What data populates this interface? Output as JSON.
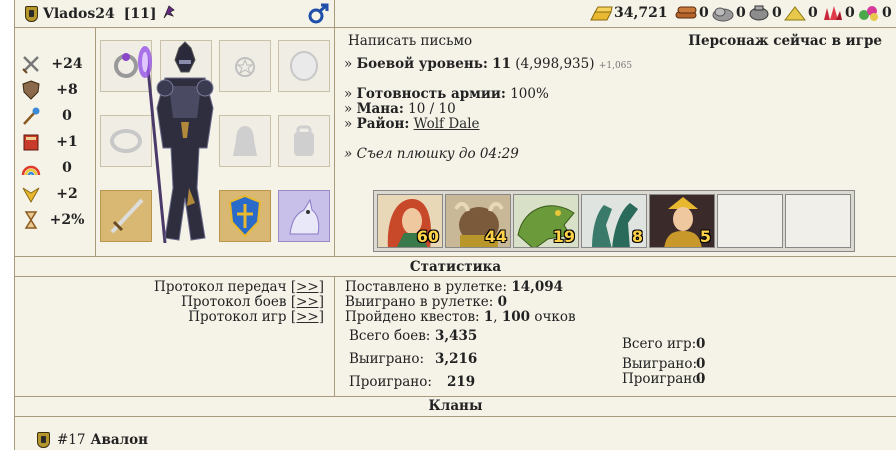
{
  "player": {
    "name": "Vlados24",
    "level_badge": "[11]",
    "gender_icon": "male-icon"
  },
  "resources": [
    {
      "name": "gold",
      "value": "34,721",
      "color": "#e8b830"
    },
    {
      "name": "wood",
      "value": "0",
      "color": "#b5652a"
    },
    {
      "name": "ore",
      "value": "0",
      "color": "#9a9a9a"
    },
    {
      "name": "mercury",
      "value": "0",
      "color": "#8c8c8c"
    },
    {
      "name": "sulfur",
      "value": "0",
      "color": "#e8c84a"
    },
    {
      "name": "crystals",
      "value": "0",
      "color": "#c8283a"
    },
    {
      "name": "gems",
      "value": "0",
      "color": "#4aa84a"
    }
  ],
  "stats": [
    {
      "icon": "attack-icon",
      "value": "+24"
    },
    {
      "icon": "defense-icon",
      "value": "+8"
    },
    {
      "icon": "spellpower-icon",
      "value": "0"
    },
    {
      "icon": "knowledge-icon",
      "value": "+1"
    },
    {
      "icon": "luck-icon",
      "value": "0"
    },
    {
      "icon": "morale-icon",
      "value": "+2"
    },
    {
      "icon": "initiative-icon",
      "value": "+2%"
    }
  ],
  "profile": {
    "write_letter": "Написать письмо",
    "online_status": "Персонаж сейчас в игре",
    "combat_level_label": "Боевой уровень:",
    "combat_level": "11",
    "experience": "(4,998,935)",
    "exp_gain": "+1,065",
    "army_ready_label": "Готовность армии:",
    "army_ready": "100%",
    "mana_label": "Мана:",
    "mana": "10 / 10",
    "district_label": "Район:",
    "district": "Wolf Dale",
    "effect": "Съел плюшку до 04:29"
  },
  "army": [
    {
      "unit": "dryad-icon",
      "count": "60"
    },
    {
      "unit": "minotaur-icon",
      "count": "44"
    },
    {
      "unit": "lizard-icon",
      "count": "19"
    },
    {
      "unit": "hydra-icon",
      "count": "8"
    },
    {
      "unit": "elf-sorceress-icon",
      "count": "5"
    },
    {
      "unit": "",
      "count": ""
    },
    {
      "unit": "",
      "count": ""
    }
  ],
  "statistics": {
    "title": "Статистика",
    "links": [
      {
        "label": "Протокол передач",
        "link": "[>>]"
      },
      {
        "label": "Протокол боев",
        "link": "[>>]"
      },
      {
        "label": "Протокол игр",
        "link": "[>>]"
      }
    ],
    "roulette_bet_label": "Поставлено в рулетке:",
    "roulette_bet": "14,094",
    "roulette_won_label": "Выиграно в рулетке:",
    "roulette_won": "0",
    "quests_label": "Пройдено квестов:",
    "quests_count": "1",
    "quests_points": "100",
    "quests_points_suffix": "очков",
    "battles": {
      "total_label": "Всего боев:",
      "total": "3,435",
      "won_label": "Выиграно:",
      "won": "3,216",
      "lost_label": "Проиграно:",
      "lost": "219"
    },
    "games": {
      "total_label": "Всего игр:",
      "total": "0",
      "won_label": "Выиграно:",
      "won": "0",
      "lost_label": "Проиграно:",
      "lost": "0"
    }
  },
  "clans": {
    "title": "Кланы",
    "items": [
      {
        "number": "#17",
        "name": "Авалон"
      }
    ]
  }
}
